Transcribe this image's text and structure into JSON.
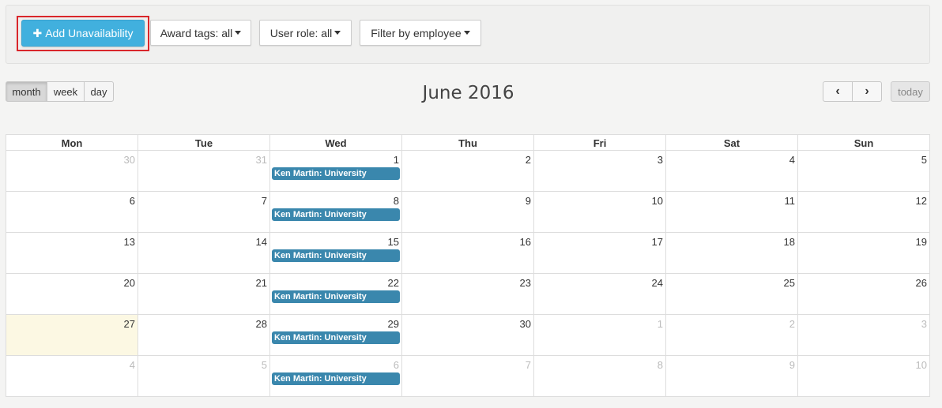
{
  "toolbar": {
    "add_label": "Add Unavailability",
    "award_tags_label": "Award tags: all",
    "user_role_label": "User role: all",
    "filter_employee_label": "Filter by employee"
  },
  "views": {
    "month": "month",
    "week": "week",
    "day": "day",
    "active": "month"
  },
  "calendar": {
    "title": "June 2016",
    "nav": {
      "prev": "‹",
      "next": "›",
      "today": "today"
    },
    "weekdays": [
      "Mon",
      "Tue",
      "Wed",
      "Thu",
      "Fri",
      "Sat",
      "Sun"
    ],
    "today_cell": {
      "week": 4,
      "day": 0
    },
    "weeks": [
      [
        "30",
        "31",
        "1",
        "2",
        "3",
        "4",
        "5"
      ],
      [
        "6",
        "7",
        "8",
        "9",
        "10",
        "11",
        "12"
      ],
      [
        "13",
        "14",
        "15",
        "16",
        "17",
        "18",
        "19"
      ],
      [
        "20",
        "21",
        "22",
        "23",
        "24",
        "25",
        "26"
      ],
      [
        "27",
        "28",
        "29",
        "30",
        "1",
        "2",
        "3"
      ],
      [
        "4",
        "5",
        "6",
        "7",
        "8",
        "9",
        "10"
      ]
    ],
    "other_month": [
      [
        true,
        true,
        false,
        false,
        false,
        false,
        false
      ],
      [
        false,
        false,
        false,
        false,
        false,
        false,
        false
      ],
      [
        false,
        false,
        false,
        false,
        false,
        false,
        false
      ],
      [
        false,
        false,
        false,
        false,
        false,
        false,
        false
      ],
      [
        false,
        false,
        false,
        false,
        true,
        true,
        true
      ],
      [
        true,
        true,
        true,
        true,
        true,
        true,
        true
      ]
    ],
    "events": [
      {
        "week": 0,
        "day": 2,
        "label": "Ken Martin: University"
      },
      {
        "week": 1,
        "day": 2,
        "label": "Ken Martin: University"
      },
      {
        "week": 2,
        "day": 2,
        "label": "Ken Martin: University"
      },
      {
        "week": 3,
        "day": 2,
        "label": "Ken Martin: University"
      },
      {
        "week": 4,
        "day": 2,
        "label": "Ken Martin: University"
      },
      {
        "week": 5,
        "day": 2,
        "label": "Ken Martin: University"
      }
    ],
    "event_color": "#3a87ad",
    "today_color": "#fcf8e3"
  },
  "colors": {
    "primary": "#41b0de",
    "highlight": "#d9262b"
  }
}
